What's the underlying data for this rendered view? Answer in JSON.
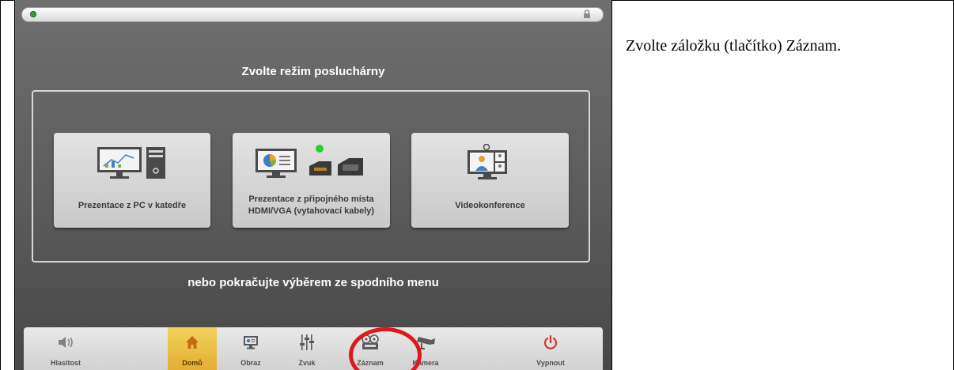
{
  "screen": {
    "title": "Zvolte režim posluchárny",
    "subtitle": "nebo pokračujte výběrem ze spodního menu"
  },
  "modes": [
    {
      "label": "Prezentace z PC v katedře",
      "icon": "pc-presentation-icon"
    },
    {
      "label": "Prezentace z připojného místa HDMI/VGA (vytahovací kabely)",
      "icon": "hdmi-vga-connection-icon"
    },
    {
      "label": "Videokonference",
      "icon": "videoconference-icon"
    }
  ],
  "menu": {
    "items": [
      {
        "label": "Hlasitost",
        "icon": "speaker-icon"
      },
      {
        "label": "Domů",
        "icon": "home-icon",
        "active": true
      },
      {
        "label": "Obraz",
        "icon": "display-icon"
      },
      {
        "label": "Zvuk",
        "icon": "mixer-icon"
      },
      {
        "label": "Záznam",
        "icon": "recorder-icon"
      },
      {
        "label": "Kamera",
        "icon": "camera-icon"
      },
      {
        "label": "Vypnout",
        "icon": "power-icon"
      }
    ]
  },
  "instruction": {
    "text": "Zvolte záložku (tlačítko) Záznam."
  },
  "colors": {
    "active_tab": "#e9b43a",
    "highlight": "#e0181e",
    "power": "#d9332b",
    "status_dot": "#3d9c3d"
  }
}
